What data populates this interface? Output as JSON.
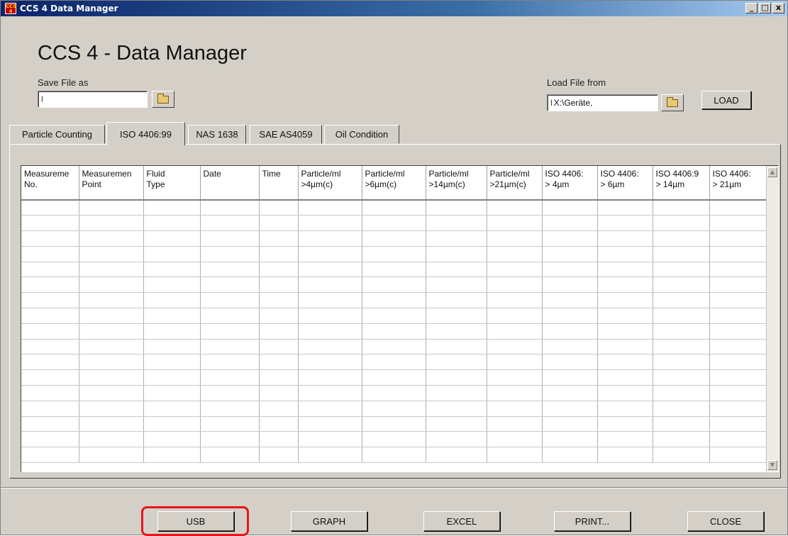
{
  "window": {
    "title": "CCS 4 Data Manager",
    "icon_text": "CCS 4",
    "controls": {
      "minimize": "_",
      "maximize": "□",
      "close": "x"
    }
  },
  "app_title": "CCS 4 - Data Manager",
  "save": {
    "label": "Save File as",
    "value": "",
    "prefix": "ꟾ"
  },
  "load": {
    "label": "Load File from",
    "value": "X:\\Geräte,",
    "prefix": "ꟾ",
    "button": "LOAD"
  },
  "tabs": [
    {
      "label": "Particle Counting"
    },
    {
      "label": "ISO 4406:99"
    },
    {
      "label": "NAS 1638"
    },
    {
      "label": "SAE AS4059"
    },
    {
      "label": "Oil Condition"
    }
  ],
  "active_tab": "ISO 4406:99",
  "table": {
    "columns": [
      {
        "l1": "Measureme",
        "l2": "No."
      },
      {
        "l1": "Measuremen",
        "l2": "Point"
      },
      {
        "l1": "Fluid",
        "l2": "Type"
      },
      {
        "l1": "Date",
        "l2": ""
      },
      {
        "l1": "Time",
        "l2": ""
      },
      {
        "l1": "Particle/ml",
        "l2": ">4µm(c)"
      },
      {
        "l1": "Particle/ml",
        "l2": ">6µm(c)"
      },
      {
        "l1": "Particle/ml",
        "l2": ">14µm(c)"
      },
      {
        "l1": "Particle/ml",
        "l2": ">21µm(c)"
      },
      {
        "l1": "ISO 4406:",
        "l2": "> 4µm"
      },
      {
        "l1": "ISO 4406:",
        "l2": "> 6µm"
      },
      {
        "l1": "ISO 4406:9",
        "l2": "> 14µm"
      },
      {
        "l1": "ISO 4406:",
        "l2": "> 21µm"
      }
    ],
    "rows": [
      [
        "",
        "",
        "",
        "",
        "",
        "",
        "",
        "",
        "",
        "",
        "",
        "",
        ""
      ],
      [
        "",
        "",
        "",
        "",
        "",
        "",
        "",
        "",
        "",
        "",
        "",
        "",
        ""
      ],
      [
        "",
        "",
        "",
        "",
        "",
        "",
        "",
        "",
        "",
        "",
        "",
        "",
        ""
      ],
      [
        "",
        "",
        "",
        "",
        "",
        "",
        "",
        "",
        "",
        "",
        "",
        "",
        ""
      ],
      [
        "",
        "",
        "",
        "",
        "",
        "",
        "",
        "",
        "",
        "",
        "",
        "",
        ""
      ],
      [
        "",
        "",
        "",
        "",
        "",
        "",
        "",
        "",
        "",
        "",
        "",
        "",
        ""
      ],
      [
        "",
        "",
        "",
        "",
        "",
        "",
        "",
        "",
        "",
        "",
        "",
        "",
        ""
      ],
      [
        "",
        "",
        "",
        "",
        "",
        "",
        "",
        "",
        "",
        "",
        "",
        "",
        ""
      ],
      [
        "",
        "",
        "",
        "",
        "",
        "",
        "",
        "",
        "",
        "",
        "",
        "",
        ""
      ],
      [
        "",
        "",
        "",
        "",
        "",
        "",
        "",
        "",
        "",
        "",
        "",
        "",
        ""
      ],
      [
        "",
        "",
        "",
        "",
        "",
        "",
        "",
        "",
        "",
        "",
        "",
        "",
        ""
      ],
      [
        "",
        "",
        "",
        "",
        "",
        "",
        "",
        "",
        "",
        "",
        "",
        "",
        ""
      ],
      [
        "",
        "",
        "",
        "",
        "",
        "",
        "",
        "",
        "",
        "",
        "",
        "",
        ""
      ],
      [
        "",
        "",
        "",
        "",
        "",
        "",
        "",
        "",
        "",
        "",
        "",
        "",
        ""
      ],
      [
        "",
        "",
        "",
        "",
        "",
        "",
        "",
        "",
        "",
        "",
        "",
        "",
        ""
      ],
      [
        "",
        "",
        "",
        "",
        "",
        "",
        "",
        "",
        "",
        "",
        "",
        "",
        ""
      ],
      [
        "",
        "",
        "",
        "",
        "",
        "",
        "",
        "",
        "",
        "",
        "",
        "",
        ""
      ]
    ]
  },
  "buttons": {
    "usb": "USB",
    "graph": "GRAPH",
    "excel": "EXCEL",
    "print": "PRINT...",
    "close": "CLOSE"
  },
  "annotation_color": "#e8141c"
}
